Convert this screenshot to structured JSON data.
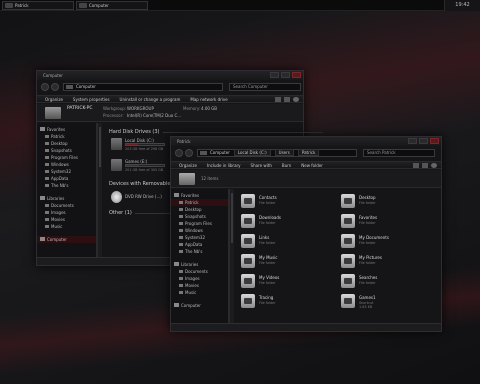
{
  "taskbar": {
    "buttons": [
      {
        "label": "Patrick"
      },
      {
        "label": "Computer"
      }
    ],
    "clock": "19:42"
  },
  "win1": {
    "title": "Computer",
    "crumb": "Computer",
    "search": "Search Computer",
    "cmd": [
      "Organize",
      "System properties",
      "Uninstall or change a program",
      "Map network drive"
    ],
    "details": {
      "name": "PATRICK-PC",
      "workgroup_label": "Workgroup:",
      "workgroup": "WORKGROUP",
      "memory_label": "Memory:",
      "memory": "4.00 GB",
      "processor_label": "Processor:",
      "processor": "Intel(R) Core(TM)2 Duo C..."
    },
    "sidebar": [
      {
        "label": "Favorites",
        "header": true
      },
      {
        "label": "Patrick"
      },
      {
        "label": "Desktop"
      },
      {
        "label": "Snapshots"
      },
      {
        "label": "Program Files"
      },
      {
        "label": "Windows"
      },
      {
        "label": "System32"
      },
      {
        "label": "AppData"
      },
      {
        "label": "The Nb's"
      },
      {
        "label": "Libraries",
        "header": true
      },
      {
        "label": "Documents"
      },
      {
        "label": "Images"
      },
      {
        "label": "Movies"
      },
      {
        "label": "Music"
      },
      {
        "label": "Computer",
        "header": true,
        "selected": true
      }
    ],
    "sections": {
      "hdd": "Hard Disk Drives (3)",
      "removable": "Devices with Removable...",
      "other": "Other (1)"
    },
    "drives": [
      {
        "name": "Local Disk (C:)",
        "free": "203 GB free of 298 GB",
        "used": 0.32
      },
      {
        "name": "Games (E:)",
        "free": "201 GB free of 305 GB",
        "used": 0.34
      }
    ],
    "dvd": "DVD RW Drive (...)"
  },
  "win2": {
    "title": "Patrick",
    "crumbs": [
      "Computer",
      "Local Disk (C:)",
      "Users",
      "Patrick"
    ],
    "search": "Search Patrick",
    "cmd": [
      "Organize",
      "Include in library",
      "Share with",
      "Burn",
      "New folder"
    ],
    "details": "12 items",
    "sidebar": [
      {
        "label": "Favorites",
        "header": true
      },
      {
        "label": "Patrick",
        "selected": true
      },
      {
        "label": "Desktop"
      },
      {
        "label": "Snapshots"
      },
      {
        "label": "Program Files"
      },
      {
        "label": "Windows"
      },
      {
        "label": "System32"
      },
      {
        "label": "AppData"
      },
      {
        "label": "The Nb's"
      },
      {
        "label": "Libraries",
        "header": true
      },
      {
        "label": "Documents"
      },
      {
        "label": "Images"
      },
      {
        "label": "Movies"
      },
      {
        "label": "Music"
      },
      {
        "label": "Computer",
        "header": true
      }
    ],
    "items": [
      {
        "name": "Contacts",
        "type": "File folder",
        "icon": "contacts-icon"
      },
      {
        "name": "Desktop",
        "type": "File folder",
        "icon": "desktop-icon"
      },
      {
        "name": "Downloads",
        "type": "File folder",
        "icon": "downloads-icon"
      },
      {
        "name": "Favorites",
        "type": "File folder",
        "icon": "favorites-icon"
      },
      {
        "name": "Links",
        "type": "File folder",
        "icon": "links-icon"
      },
      {
        "name": "My Documents",
        "type": "File folder",
        "icon": "documents-icon"
      },
      {
        "name": "My Music",
        "type": "File folder",
        "icon": "music-icon"
      },
      {
        "name": "My Pictures",
        "type": "File folder",
        "icon": "pictures-icon"
      },
      {
        "name": "My Videos",
        "type": "File folder",
        "icon": "videos-icon"
      },
      {
        "name": "Searches",
        "type": "File folder",
        "icon": "searches-icon"
      },
      {
        "name": "Tracing",
        "type": "File folder",
        "icon": "tracing-icon"
      },
      {
        "name": "Games1",
        "type": "Shortcut",
        "size": "1.63 KB",
        "icon": "games-icon"
      }
    ]
  }
}
